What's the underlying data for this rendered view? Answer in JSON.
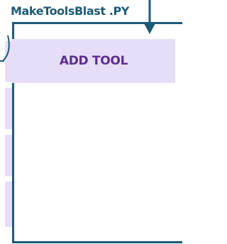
{
  "title": "MakeToolsBlast .PY",
  "panel": {
    "button_label": "ADD TOOL"
  },
  "colors": {
    "frame": "#1d5a78",
    "button_bg": "#e6def8",
    "button_text": "#5b2e8e"
  }
}
